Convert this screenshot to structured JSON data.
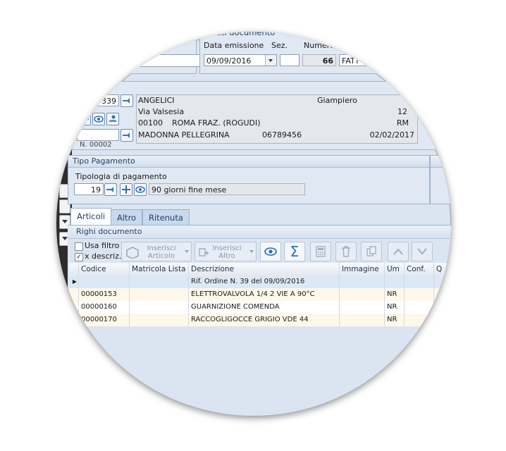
{
  "documento": {
    "header": "Dati documento",
    "data_emissione_label": "Data emissione",
    "data_emissione": "09/09/2016",
    "sez_label": "Sez.",
    "numero_label": "Numero",
    "numero": "66",
    "tipo": "FATT"
  },
  "cliente": {
    "header_fragment": "e",
    "code": "339",
    "nome": "ANGELICI",
    "cognome": "Giampiero",
    "via": "Via Valsesia",
    "civico": "12",
    "cap": "00100",
    "citta": "ROMA FRAZ. (ROGUDI)",
    "prov": "RM",
    "contatto": "MADONNA PELLEGRINA",
    "telefono": "06789456",
    "data": "02/02/2017",
    "n_fragment": "N. 00002"
  },
  "pagamento": {
    "header": "Tipo Pagamento",
    "label": "Tipologia di pagamento",
    "code": "19",
    "descrizione": "90 giorni fine mese"
  },
  "tabs": [
    "Articoli",
    "Altro",
    "Ritenuta"
  ],
  "righe": {
    "header": "Righi documento",
    "usa_filtro": "Usa filtro",
    "x_descriz": "x descriz.",
    "inserisci_articolo": [
      "Inserisci",
      "Articolo"
    ],
    "inserisci_altro": [
      "Inserisci",
      "Altro"
    ]
  },
  "grid": {
    "columns": [
      "Codice",
      "Matricola Lista",
      "Descrizione",
      "Immagine",
      "Um",
      "Conf.",
      "Q"
    ],
    "rows": [
      {
        "codice": "",
        "matricola": "",
        "descrizione": "Rif. Ordine N. 39 del 09/09/2016",
        "immagine": "",
        "um": "",
        "conf": ""
      },
      {
        "codice": "00000153",
        "matricola": "",
        "descrizione": "ELETTROVALVOLA 1/4 2 VIE A 90°C",
        "immagine": "",
        "um": "NR",
        "conf": ""
      },
      {
        "codice": "00000160",
        "matricola": "",
        "descrizione": "GUARNIZIONE COMENDA",
        "immagine": "",
        "um": "NR",
        "conf": ""
      },
      {
        "codice": "00000170",
        "matricola": "",
        "descrizione": "RACCOGLIGOCCE GRIGIO VDE 44",
        "immagine": "",
        "um": "NR",
        "conf": ""
      }
    ]
  },
  "colors": {
    "accent": "#2e6fb4",
    "panel": "#dfe8f3",
    "header_text": "#27416b"
  }
}
